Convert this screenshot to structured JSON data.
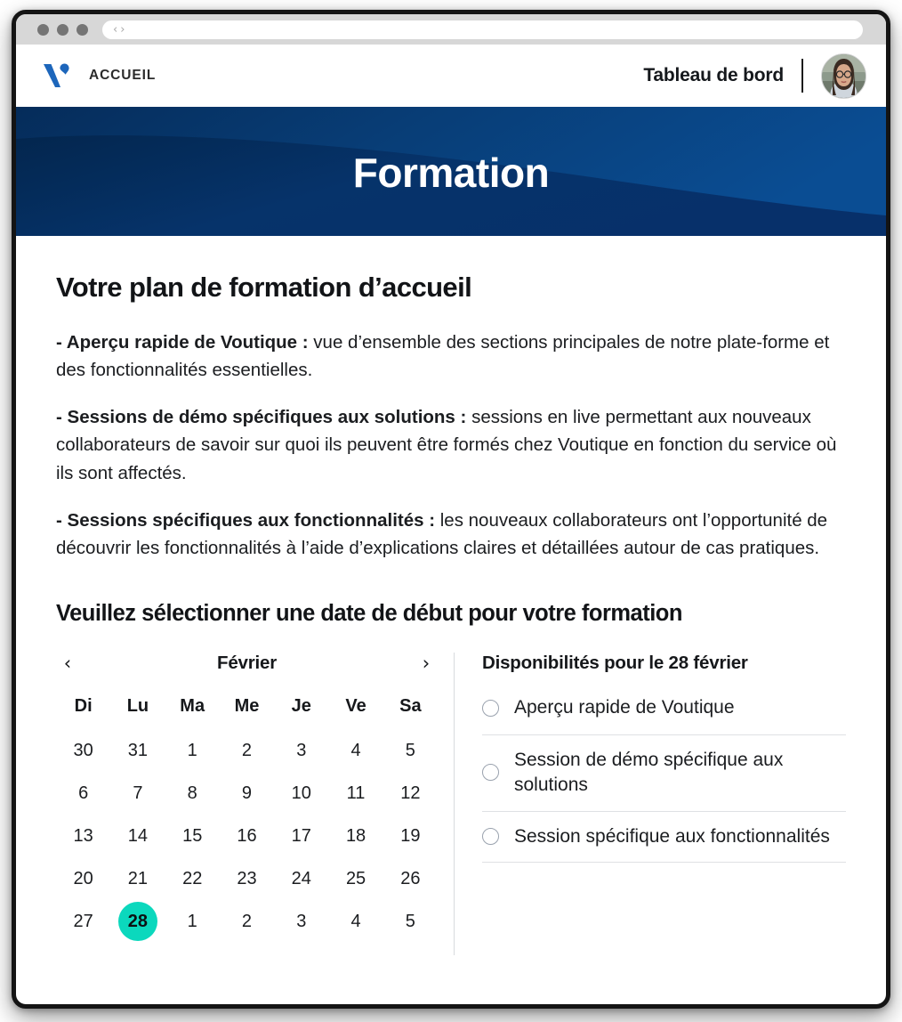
{
  "browser": {
    "back_icon": "chevron-left-icon",
    "forward_icon": "chevron-right-icon",
    "back_glyph": "‹",
    "forward_glyph": "›",
    "url_value": ""
  },
  "header": {
    "brand_label": "ACCUEIL",
    "logo_icon": "voutique-v-logo",
    "dashboard_label": "Tableau de bord",
    "avatar_name": "user-avatar"
  },
  "hero": {
    "title": "Formation",
    "color_dark": "#042a56",
    "color_mid": "#073a74",
    "color_light": "#0a4a8e"
  },
  "content": {
    "plan_title": "Votre plan de formation d’accueil",
    "paragraphs": [
      {
        "bold": "- Aperçu rapide de Voutique :",
        "rest": " vue d’ensemble des sections principales de notre plate-forme et des fonctionnalités essentielles."
      },
      {
        "bold": "-  Sessions de démo spécifiques aux solutions :",
        "rest": " sessions en live permettant aux nouveaux collaborateurs de savoir sur quoi ils peuvent être formés chez Voutique en fonction du service où ils sont affectés."
      },
      {
        "bold": "-  Sessions spécifiques aux fonctionnalités :",
        "rest": " les nouveaux collaborateurs ont l’opportunité de découvrir les fonctionnalités à l’aide d’explications claires et détaillées autour de cas pratiques."
      }
    ],
    "select_title": "Veuillez sélectionner une date de début pour votre formation"
  },
  "calendar": {
    "prev_glyph": "‹",
    "next_glyph": "›",
    "month_label": "Février",
    "weekdays": [
      "Di",
      "Lu",
      "Ma",
      "Me",
      "Je",
      "Ve",
      "Sa"
    ],
    "weeks": [
      [
        "30",
        "31",
        "1",
        "2",
        "3",
        "4",
        "5"
      ],
      [
        "6",
        "7",
        "8",
        "9",
        "10",
        "11",
        "12"
      ],
      [
        "13",
        "14",
        "15",
        "16",
        "17",
        "18",
        "19"
      ],
      [
        "20",
        "21",
        "22",
        "23",
        "24",
        "25",
        "26"
      ],
      [
        "27",
        "28",
        "1",
        "2",
        "3",
        "4",
        "5"
      ]
    ],
    "selected_day": "28",
    "selected_week_index": 4,
    "selected_col_index": 1,
    "selected_color": "#0bd8bd"
  },
  "availability": {
    "title": "Disponibilités pour le 28 février",
    "options": [
      "Aperçu rapide de Voutique",
      "Session de démo spécifique aux solutions",
      "Session spécifique aux fonctionnalités"
    ]
  }
}
